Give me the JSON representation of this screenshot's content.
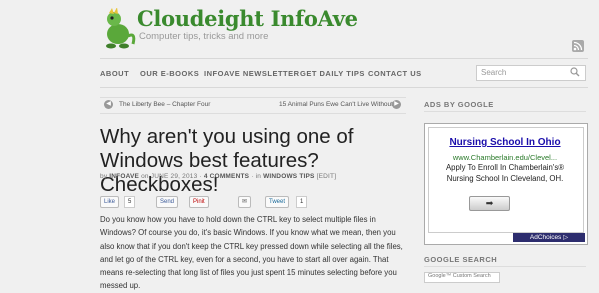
{
  "site": {
    "title": "Cloudeight InfoAve",
    "tagline": "Computer tips, tricks and more"
  },
  "nav": [
    "ABOUT",
    "OUR E-BOOKS",
    "INFOAVE NEWSLETTER",
    "GET DAILY TIPS",
    "CONTACT US"
  ],
  "search": {
    "placeholder": "Search"
  },
  "post_nav": {
    "prev": "The Liberty Bee – Chapter Four",
    "next": "15 Animal Puns Ewe Can't Live Without"
  },
  "post": {
    "title": "Why aren't you using one of Windows best features? Checkboxes!",
    "meta": {
      "by": "by",
      "author": "INFOAVE",
      "on": "on JUNE 29, 2013",
      "sep": "·",
      "comments": "4 COMMENTS",
      "in": "· in",
      "category": "WINDOWS TIPS",
      "edit": "[EDIT]"
    },
    "body": "Do you know how you have to hold down the CTRL key to select multiple files in Windows? Of course you do, it's basic Windows. If you know what we mean, then you also know that if you don't keep the CTRL key pressed down while selecting all the files, and let go of the CTRL key, even for a second, you have to start all over again. That means re-selecting that long list of files you just spent 15 minutes selecting before you messed up."
  },
  "share": {
    "like": "Like",
    "like_count": "5",
    "send": "Send",
    "pin": "Pinit",
    "email": "✉",
    "tweet": "Tweet",
    "tweet_count": "1"
  },
  "sidebar": {
    "ads_heading": "ADS BY GOOGLE",
    "ad": {
      "title": "Nursing School In Ohio",
      "url": "www.Chamberlain.edu/Clevel...",
      "desc": "Apply To Enroll In Chamberlain's® Nursing School In Cleveland, OH.",
      "button": "➡",
      "adchoices": "AdChoices ▷"
    },
    "gsearch_heading": "GOOGLE SEARCH",
    "gsearch_label": "Google™ Custom Search"
  },
  "colors": {
    "brand": "#3a8a2e",
    "ad_link": "#1a0dab",
    "ad_url": "#2a7a2a"
  }
}
